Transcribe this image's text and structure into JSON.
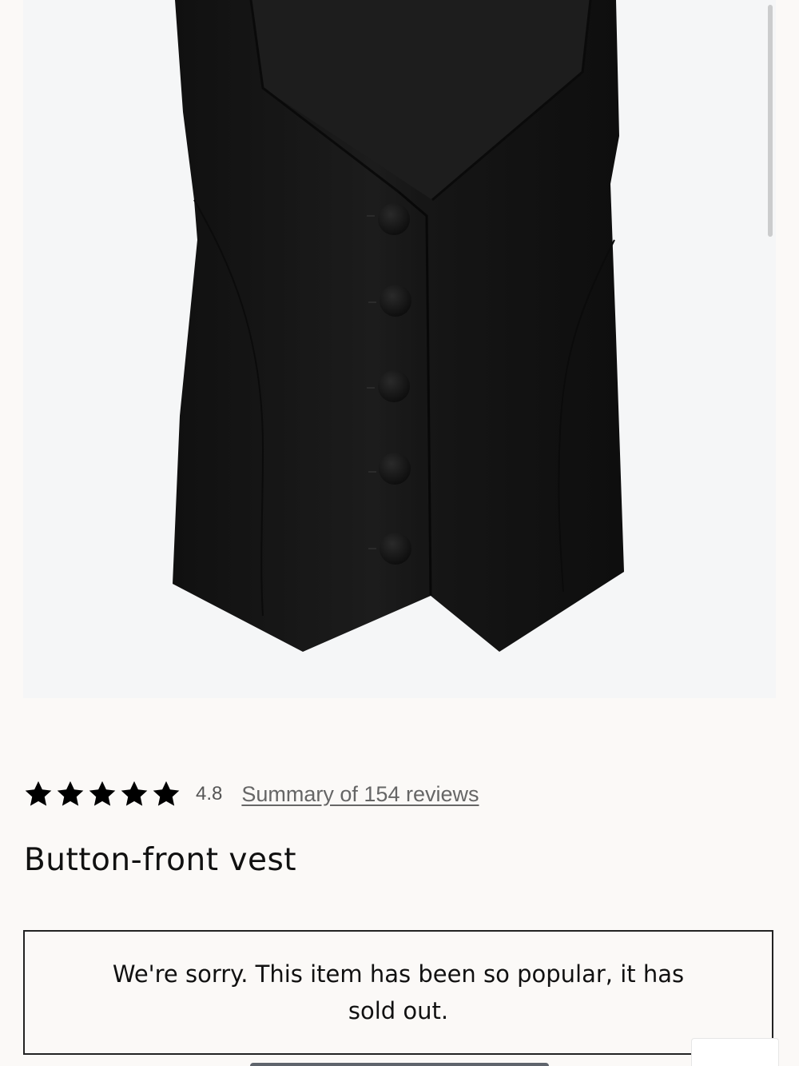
{
  "product": {
    "name": "Button-front vest",
    "image_alt": "Black button-front vest with five covered buttons",
    "rating": {
      "value": "4.8",
      "stars": 5,
      "reviews_link": "Summary of 154 reviews"
    },
    "availability_message": "We're sorry. This item has been so popular, it has sold out."
  },
  "icons": {
    "star": "star-filled-icon"
  },
  "colors": {
    "background": "#fbf9f7",
    "image_background": "#f5f6f7",
    "garment": "#141414",
    "text": "#111111",
    "muted_text": "#666666",
    "border": "#222222"
  }
}
